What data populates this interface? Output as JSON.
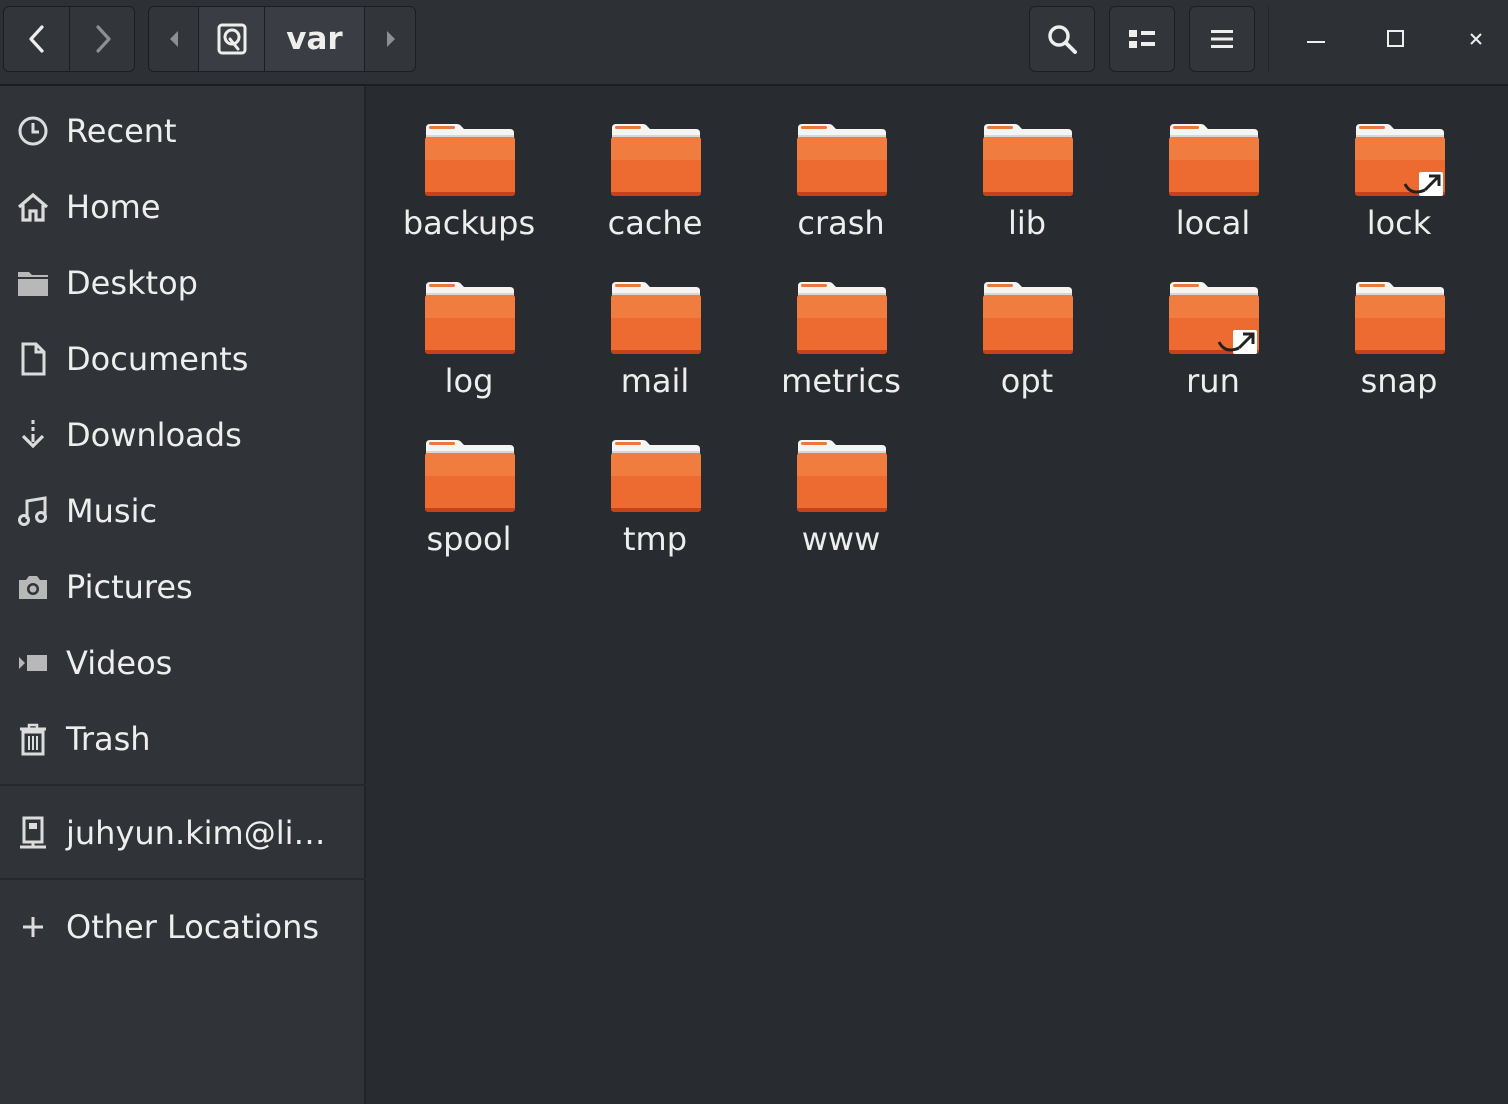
{
  "header": {
    "path_current": "var",
    "icons": {
      "back": "go-back-icon",
      "forward": "go-forward-icon",
      "path_left": "path-scroll-left-icon",
      "disk": "drive-icon",
      "path_right": "path-scroll-right-icon",
      "search": "search-icon",
      "view": "list-view-icon",
      "menu": "hamburger-menu-icon",
      "minimize": "minimize-icon",
      "maximize": "maximize-icon",
      "close": "close-icon"
    }
  },
  "sidebar": {
    "items": [
      {
        "label": "Recent",
        "icon": "clock-icon"
      },
      {
        "label": "Home",
        "icon": "home-icon"
      },
      {
        "label": "Desktop",
        "icon": "folder-icon"
      },
      {
        "label": "Documents",
        "icon": "document-icon"
      },
      {
        "label": "Downloads",
        "icon": "download-icon"
      },
      {
        "label": "Music",
        "icon": "music-note-icon"
      },
      {
        "label": "Pictures",
        "icon": "camera-icon"
      },
      {
        "label": "Videos",
        "icon": "video-icon"
      },
      {
        "label": "Trash",
        "icon": "trash-icon"
      }
    ],
    "network": {
      "label": "juhyun.kim@li…",
      "icon": "remote-server-icon"
    },
    "other": {
      "label": "Other Locations",
      "icon": "plus-icon"
    }
  },
  "files": [
    {
      "name": "backups",
      "link": false
    },
    {
      "name": "cache",
      "link": false
    },
    {
      "name": "crash",
      "link": false
    },
    {
      "name": "lib",
      "link": false
    },
    {
      "name": "local",
      "link": false
    },
    {
      "name": "lock",
      "link": true
    },
    {
      "name": "log",
      "link": false
    },
    {
      "name": "mail",
      "link": false
    },
    {
      "name": "metrics",
      "link": false
    },
    {
      "name": "opt",
      "link": false
    },
    {
      "name": "run",
      "link": true
    },
    {
      "name": "snap",
      "link": false
    },
    {
      "name": "spool",
      "link": false
    },
    {
      "name": "tmp",
      "link": false
    },
    {
      "name": "www",
      "link": false
    }
  ],
  "colors": {
    "folder_orange": "#e95420",
    "background": "#282b30",
    "sidebar": "#303338",
    "text": "#eeeeec"
  }
}
